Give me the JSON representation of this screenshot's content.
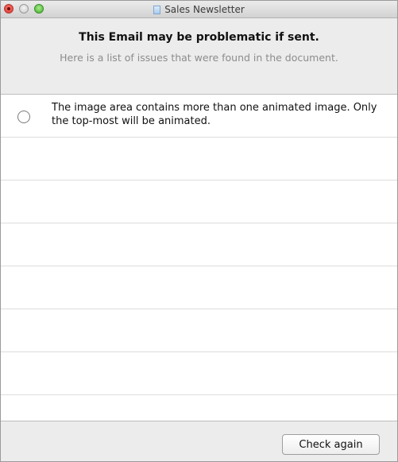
{
  "window": {
    "title": "Sales Newsletter"
  },
  "header": {
    "headline": "This Email may be problematic if sent.",
    "subline": "Here is a list of issues that were found in the document."
  },
  "issues": [
    {
      "text": "The image area contains more than one animated image. Only the top-most will be animated.",
      "selected": false
    }
  ],
  "footer": {
    "check_again_label": "Check again"
  }
}
